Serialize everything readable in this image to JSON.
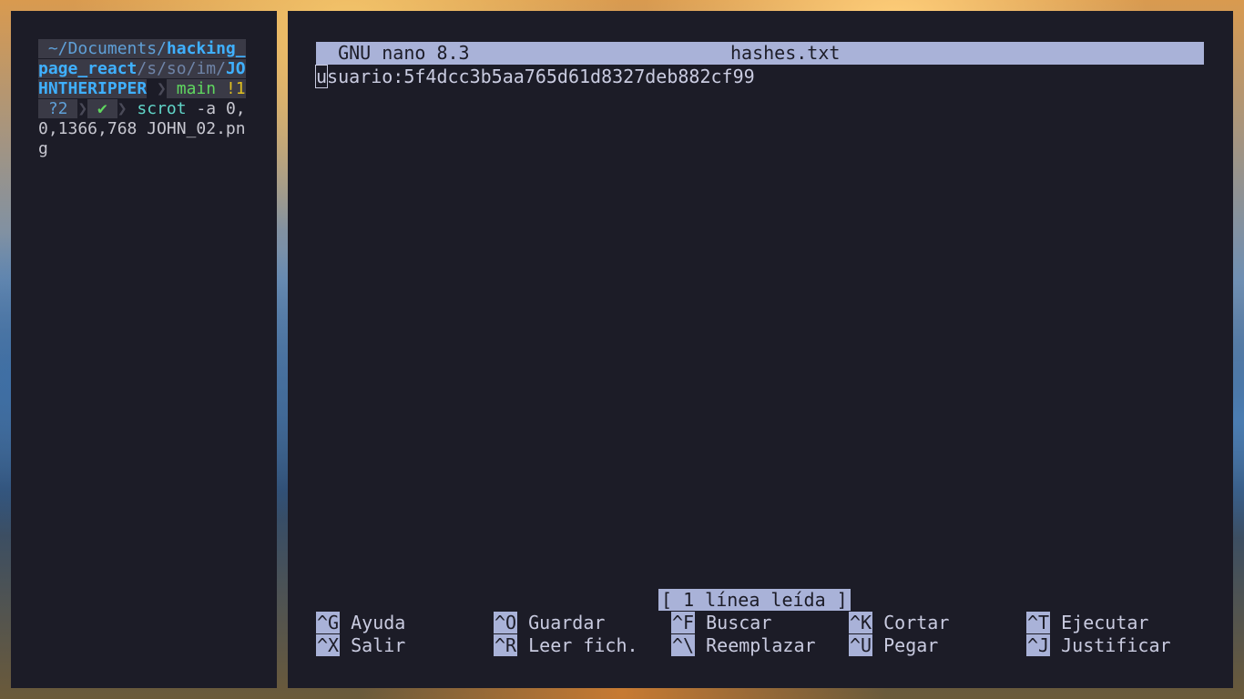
{
  "left_terminal": {
    "prompt_line1_tilde": " ~/",
    "prompt_line1_dir": "Documents/",
    "prompt_line1_bold": "hacking_",
    "prompt_line2_bold": "page_react",
    "prompt_line2_sep1": "/",
    "prompt_line2_s": "s",
    "prompt_line2_sep2": "/",
    "prompt_line2_so": "so",
    "prompt_line2_sep3": "/",
    "prompt_line2_im": "im",
    "prompt_line2_sep4": "/",
    "prompt_line2_jo": "JO",
    "prompt_line3_bold": "HNTHERIPPER",
    "prompt_branch": " main ",
    "prompt_stat1": "!1",
    "prompt_stat2": " ?2 ",
    "prompt_check": " ✔ ",
    "cmd": "scrot",
    "args_line4": " -a 0,",
    "args_line5": "0,1366,768 JOHN_02.pn",
    "args_line6": "g"
  },
  "nano": {
    "version": "  GNU nano 8.3",
    "filename": "hashes.txt",
    "cursor_char": "u",
    "content_rest": "suario:5f4dcc3b5aa765d61d8327deb882cf99",
    "status": "[ 1 línea leída ]",
    "shortcuts": [
      {
        "key": "^G",
        "label": " Ayuda"
      },
      {
        "key": "^O",
        "label": " Guardar"
      },
      {
        "key": "^F",
        "label": " Buscar"
      },
      {
        "key": "^K",
        "label": " Cortar"
      },
      {
        "key": "^T",
        "label": " Ejecutar"
      },
      {
        "key": "^X",
        "label": " Salir"
      },
      {
        "key": "^R",
        "label": " Leer fich."
      },
      {
        "key": "^\\",
        "label": " Reemplazar"
      },
      {
        "key": "^U",
        "label": " Pegar"
      },
      {
        "key": "^J",
        "label": " Justificar"
      }
    ]
  }
}
